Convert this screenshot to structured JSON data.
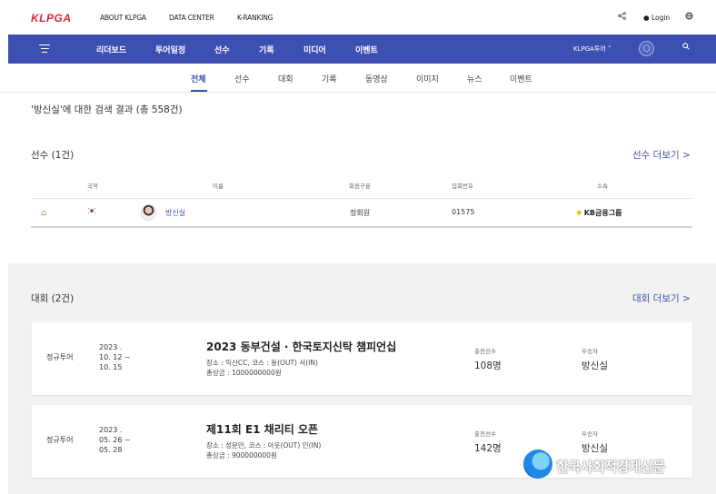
{
  "header": {
    "logo": "KLPGA",
    "links": [
      "ABOUT KLPGA",
      "DATA CENTER",
      "K-RANKING"
    ],
    "login": "Login"
  },
  "nav": {
    "items": [
      "리더보드",
      "투어일정",
      "선수",
      "기록",
      "미디어",
      "이벤트"
    ],
    "tour_select": "KLPGA투어 ˅"
  },
  "tabs": {
    "items": [
      "전체",
      "선수",
      "대회",
      "기록",
      "동영상",
      "이미지",
      "뉴스",
      "이벤트"
    ],
    "active": "전체"
  },
  "result_title": "'방신실'에 대한 검색 결과 (총 558건)",
  "players": {
    "title": "선수 (1건)",
    "more": "선수 더보기 >",
    "columns": [
      "국적",
      "이름",
      "회원구분",
      "입회번호",
      "소속"
    ],
    "rows": [
      {
        "name": "방신실",
        "member_type": "정회원",
        "member_no": "01575",
        "sponsor": "KB금융그룹"
      }
    ]
  },
  "tournaments": {
    "title": "대회 (2건)",
    "more": "대회 더보기 >",
    "entrants_label": "출전선수",
    "winner_label": "우승자",
    "items": [
      {
        "type": "정규투어",
        "date": "2023 .\n10. 12 ~\n10. 15",
        "name": "2023 동부건설 · 한국토지신탁 챔피언십",
        "venue": "장소 : 익산CC, 코스 : 동(OUT) 서(IN)",
        "prize": "총상금 : 1000000000원",
        "entrants": "108명",
        "winner": "방신실"
      },
      {
        "type": "정규투어",
        "date": "2023 .\n05. 26 ~\n05. 28",
        "name": "제11회 E1 채리티 오픈",
        "venue": "장소 : 성문안, 코스 : 아웃(OUT) 인(IN)",
        "prize": "총상금 : 900000000원",
        "entrants": "142명",
        "winner": "방신실"
      }
    ]
  },
  "watermark": "한국사회적경제신문"
}
